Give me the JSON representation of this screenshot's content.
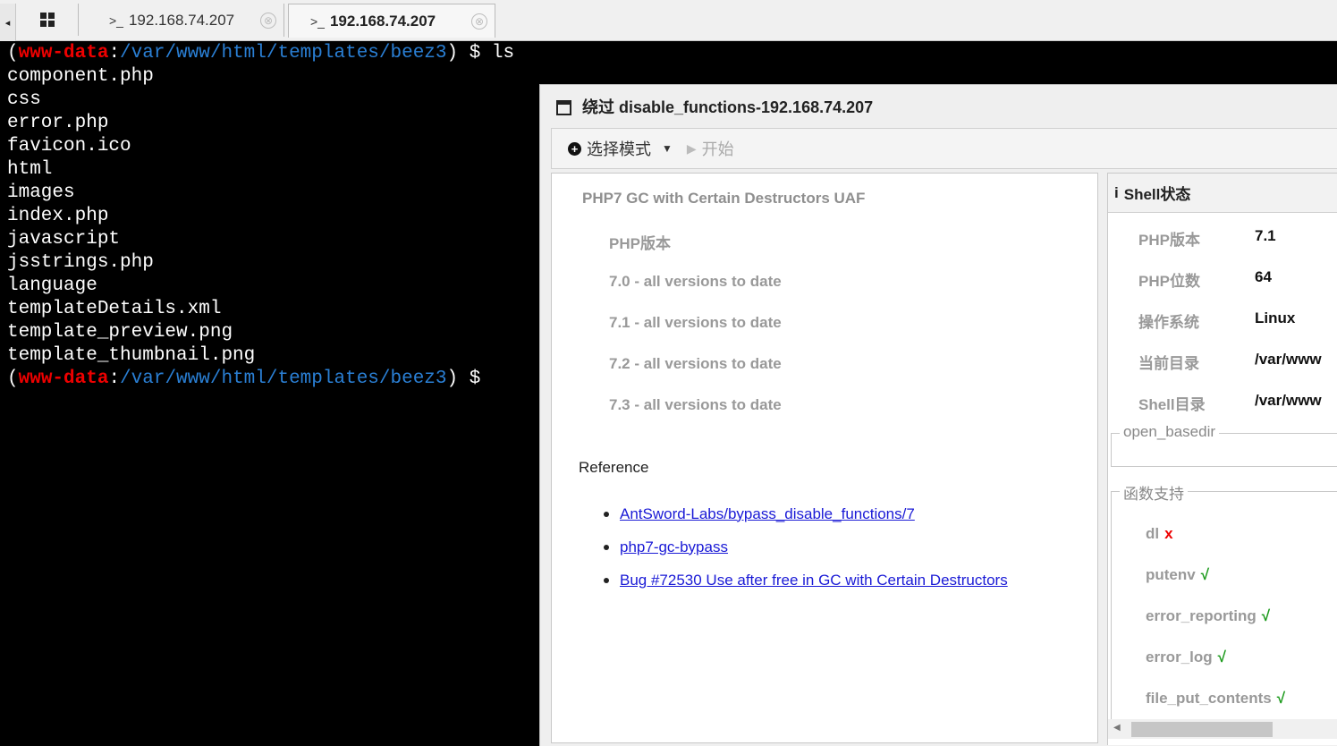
{
  "tabs": {
    "scroll_left": "◂",
    "items": [
      {
        "prompt": ">_",
        "label": "192.168.74.207",
        "close": "⊗"
      },
      {
        "prompt": ">_",
        "label": "192.168.74.207",
        "close": "⊗"
      }
    ]
  },
  "terminal": {
    "prompt_open": "(",
    "user": "www-data",
    "colon": ":",
    "path": "/var/www/html/templates/beez3",
    "prompt_close": ") $",
    "command": " ls",
    "output": [
      "component.php",
      "css",
      "error.php",
      "favicon.ico",
      "html",
      "images",
      "index.php",
      "javascript",
      "jsstrings.php",
      "language",
      "templateDetails.xml",
      "template_preview.png",
      "template_thumbnail.png"
    ]
  },
  "window": {
    "title": "绕过 disable_functions-192.168.74.207",
    "toolbar": {
      "mode_icon": "+",
      "mode_label": "选择模式",
      "caret": "▼",
      "start_icon": "▶",
      "start_label": "开始"
    },
    "exploit": {
      "title": "PHP7 GC with Certain Destructors UAF",
      "version_heading": "PHP版本",
      "versions": [
        "7.0 - all versions to date",
        "7.1 - all versions to date",
        "7.2 - all versions to date",
        "7.3 - all versions to date"
      ],
      "reference_label": "Reference",
      "references": [
        "AntSword-Labs/bypass_disable_functions/7",
        "php7-gc-bypass",
        "Bug #72530 Use after free in GC with Certain Destructors"
      ]
    },
    "shell_status": {
      "icon": "i",
      "title": "Shell状态",
      "rows": [
        {
          "key": "PHP版本",
          "value": "7.1"
        },
        {
          "key": "PHP位数",
          "value": "64"
        },
        {
          "key": "操作系统",
          "value": "Linux"
        },
        {
          "key": "当前目录",
          "value": "/var/www"
        },
        {
          "key": "Shell目录",
          "value": "/var/www"
        }
      ],
      "open_basedir_label": "open_basedir",
      "functions_label": "函数支持",
      "functions": [
        {
          "name": "dl",
          "mark": "x"
        },
        {
          "name": "putenv",
          "mark": "√"
        },
        {
          "name": "error_reporting",
          "mark": "√"
        },
        {
          "name": "error_log",
          "mark": "√"
        },
        {
          "name": "file_put_contents",
          "mark": "√"
        }
      ]
    }
  },
  "colors": {
    "terminal_bg": "#000000",
    "terminal_user": "#ee0000",
    "terminal_path": "#2a7fd4",
    "link": "#1a1ad6",
    "ok": "#1b9a1b",
    "fail": "#ee0000"
  }
}
